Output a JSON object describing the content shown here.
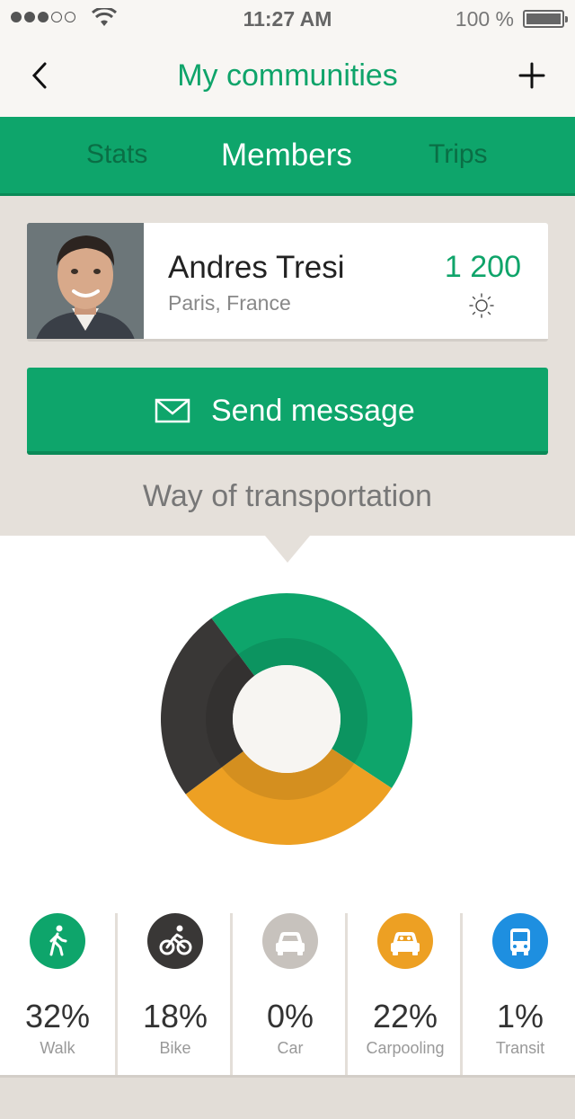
{
  "status_bar": {
    "time": "11:27 AM",
    "battery": "100 %"
  },
  "nav": {
    "title": "My communities"
  },
  "tabs": [
    {
      "label": "Stats"
    },
    {
      "label": "Members"
    },
    {
      "label": "Trips"
    }
  ],
  "profile": {
    "name": "Andres Tresi",
    "location": "Paris, France",
    "score": "1 200"
  },
  "send_button": {
    "label": "Send message"
  },
  "section_title": "Way of transportation",
  "colors": {
    "brand": "#0ea56b",
    "dark": "#393736",
    "orange": "#eda023",
    "grey": "#c7c2bd",
    "blue": "#1e8fe0"
  },
  "chart_data": {
    "type": "pie",
    "categories": [
      "Walk",
      "Bike",
      "Car",
      "Carpooling",
      "Transit"
    ],
    "values": [
      32,
      18,
      0,
      22,
      1
    ]
  },
  "modes": [
    {
      "value": "32%",
      "label": "Walk",
      "icon": "walk-icon",
      "color": "#0ea56b"
    },
    {
      "value": "18%",
      "label": "Bike",
      "icon": "bike-icon",
      "color": "#393736"
    },
    {
      "value": "0%",
      "label": "Car",
      "icon": "car-icon",
      "color": "#c7c2bd"
    },
    {
      "value": "22%",
      "label": "Carpooling",
      "icon": "carpool-icon",
      "color": "#eda023"
    },
    {
      "value": "1%",
      "label": "Transit",
      "icon": "bus-icon",
      "color": "#1e8fe0"
    }
  ]
}
